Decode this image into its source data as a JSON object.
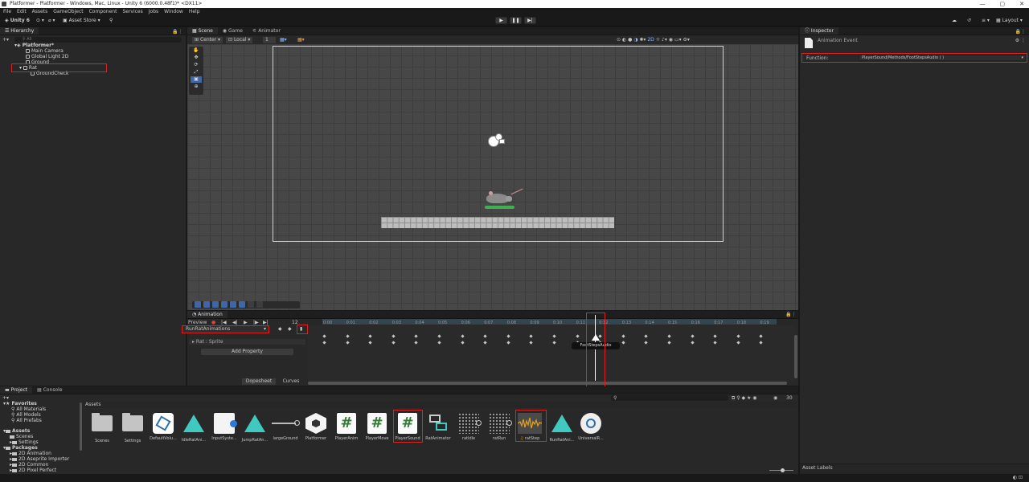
{
  "window": {
    "title": "Platformer - Platformer - Windows, Mac, Linux - Unity 6 (6000.0.48f1)* <DX11>",
    "minimize": "—",
    "maximize": "▢",
    "close": "✕"
  },
  "menu": [
    "File",
    "Edit",
    "Assets",
    "GameObject",
    "Component",
    "Services",
    "Jobs",
    "Window",
    "Help"
  ],
  "toolbar": {
    "account": "Unity 6",
    "asset_store": "Asset Store ▾",
    "layout": "Layout"
  },
  "hierarchy": {
    "tab": "Hierarchy",
    "search_placeholder": "All",
    "scene": "Platformer*",
    "items": [
      "Main Camera",
      "Global Light 2D",
      "Ground",
      "Rat",
      "GroundCheck"
    ]
  },
  "scene_view": {
    "tabs": [
      "Scene",
      "Game",
      "Animator"
    ],
    "pivot": "Center",
    "space": "Local",
    "layer_num": "1"
  },
  "animation": {
    "tab": "Animation",
    "preview": "Preview",
    "frame": "12",
    "clip": "RunRatAnimations",
    "property": "Rat : Sprite",
    "add_property": "Add Property",
    "dopesheet": "Dopesheet",
    "curves": "Curves",
    "event_tooltip": "FootStepsAudio",
    "ticks": [
      "0:00",
      "0:01",
      "0:02",
      "0:03",
      "0:04",
      "0:05",
      "0:06",
      "0:07",
      "0:08",
      "0:09",
      "0:10",
      "0:11",
      "0:12",
      "0:13",
      "0:14",
      "0:15",
      "0:16",
      "0:17",
      "0:18",
      "0:19"
    ]
  },
  "inspector": {
    "tab": "Inspector",
    "title": "Animation Event",
    "function_label": "Function:",
    "function_value": "PlayerSound/Methods/FootStepsAudio ( )",
    "asset_labels": "Asset Labels"
  },
  "project": {
    "tabs": [
      "Project",
      "Console"
    ],
    "favorites": "Favorites",
    "favorite_items": [
      "All Materials",
      "All Models",
      "All Prefabs"
    ],
    "assets_root": "Assets",
    "asset_folders": [
      "Scenes",
      "Settings"
    ],
    "packages": "Packages",
    "package_items": [
      "2D Animation",
      "2D Aseprite Importer",
      "2D Common",
      "2D Pixel Perfect"
    ],
    "breadcrumb": "Assets",
    "count": "30",
    "assets": [
      "Scenes",
      "Settings",
      "DefaultVolu...",
      "IdleRatAni...",
      "InputSyste...",
      "JumpRatAn...",
      "largeGround",
      "Platformer",
      "PlayerAnim",
      "PlayerMove",
      "PlayerSound",
      "RatAnimator",
      "ratIdle",
      "ratRun",
      "ratStep",
      "RunRatAni...",
      "UniversalR..."
    ]
  }
}
